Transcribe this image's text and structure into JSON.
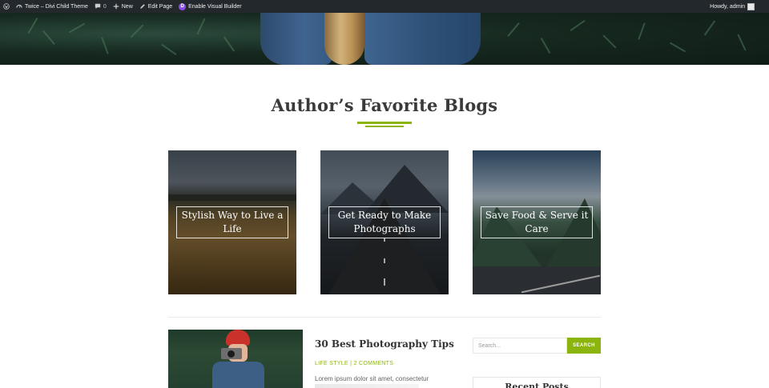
{
  "admin_bar": {
    "site_name": "Twice – Divi Child Theme",
    "comments_count": "0",
    "new_label": "New",
    "edit_label": "Edit Page",
    "builder_label": "Enable Visual Builder",
    "greeting": "Howdy, admin",
    "icons": [
      "wordpress-logo-icon",
      "dashboard-icon",
      "comment-icon",
      "plus-icon",
      "pencil-icon",
      "divi-icon",
      "avatar"
    ]
  },
  "section": {
    "title": "Author’s Favorite Blogs",
    "accent_color": "#8cb40f"
  },
  "cards": [
    {
      "label": "Stylish Way to Live a Life"
    },
    {
      "label": "Get Ready to Make Photographs"
    },
    {
      "label": "Save Food & Serve it Care"
    }
  ],
  "post": {
    "title": "30 Best Photography Tips",
    "category": "LIFE STYLE",
    "separator": "|",
    "comments": "2 COMMENTS",
    "excerpt": "Lorem ipsum dolor sit amet, consectetur"
  },
  "sidebar": {
    "search_placeholder": "Search...",
    "search_button": "SEARCH",
    "recent_title": "Recent Posts"
  }
}
